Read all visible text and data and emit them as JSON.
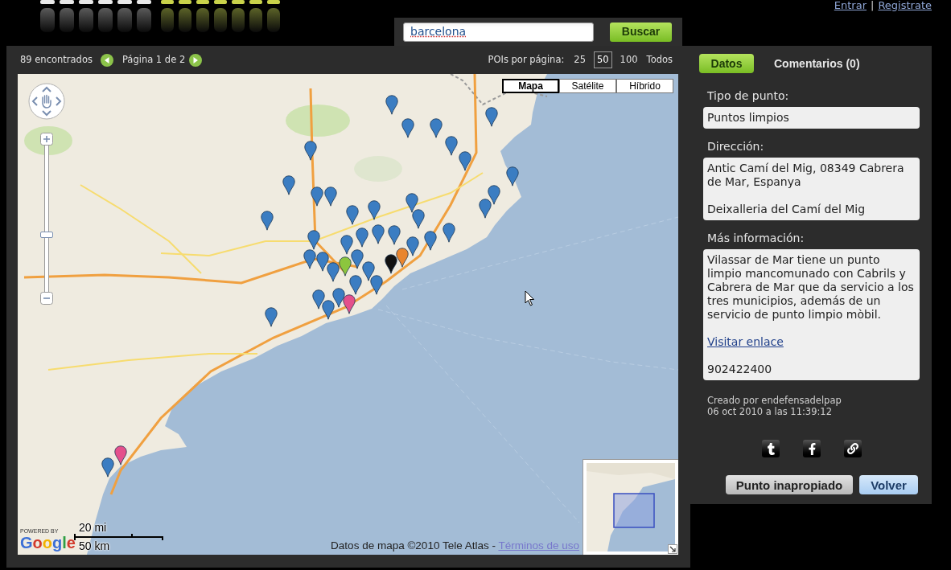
{
  "account": {
    "links": [
      {
        "label": "Entrar"
      },
      {
        "label": "Registrate"
      }
    ],
    "separator": "|"
  },
  "search": {
    "value": "barcelona",
    "button": "Buscar"
  },
  "results_bar": {
    "count": "89 encontrados",
    "page": "Página 1 de 2",
    "per_page_label": "POIs por página:",
    "per_page_options": [
      {
        "label": "25",
        "selected": false
      },
      {
        "label": "50",
        "selected": true
      },
      {
        "label": "100",
        "selected": false
      },
      {
        "label": "Todos",
        "selected": false
      }
    ]
  },
  "map": {
    "map_types": [
      {
        "label": "Mapa",
        "selected": true
      },
      {
        "label": "Satélite",
        "selected": false
      },
      {
        "label": "Híbrido",
        "selected": false
      }
    ],
    "zoom": {
      "level": 0.39
    },
    "scale": {
      "miles": "20 mi",
      "kilometers": "50 km"
    },
    "logo": {
      "caption": "POWERED BY",
      "name": "Google"
    },
    "attribution": "Datos de mapa ©2010 Tele Atlas -",
    "terms_link": "Términos de uso",
    "markers": [
      {
        "color": "#3b7dc2"
      },
      {
        "color": "#3b7dc2"
      },
      {
        "color": "#3b7dc2"
      },
      {
        "color": "#3b7dc2"
      },
      {
        "color": "#3b7dc2"
      },
      {
        "color": "#3b7dc2"
      },
      {
        "color": "#3b7dc2"
      },
      {
        "color": "#3b7dc2"
      },
      {
        "color": "#3b7dc2"
      },
      {
        "color": "#3b7dc2"
      },
      {
        "color": "#3b7dc2"
      },
      {
        "color": "#3b7dc2"
      },
      {
        "color": "#3b7dc2"
      },
      {
        "color": "#3b7dc2"
      },
      {
        "color": "#3b7dc2"
      },
      {
        "color": "#3b7dc2"
      },
      {
        "color": "#3b7dc2"
      },
      {
        "color": "#3b7dc2"
      },
      {
        "color": "#3b7dc2"
      },
      {
        "color": "#3b7dc2"
      },
      {
        "color": "#3b7dc2"
      },
      {
        "color": "#3b7dc2"
      },
      {
        "color": "#3b7dc2"
      },
      {
        "color": "#3b7dc2"
      },
      {
        "color": "#3b7dc2"
      },
      {
        "color": "#3b7dc2"
      },
      {
        "color": "#3b7dc2"
      },
      {
        "color": "#3b7dc2"
      },
      {
        "color": "#3b7dc2"
      },
      {
        "color": "#3b7dc2"
      },
      {
        "color": "#3b7dc2"
      },
      {
        "color": "#3b7dc2"
      },
      {
        "color": "#3b7dc2"
      },
      {
        "color": "#3b7dc2"
      },
      {
        "color": "#3b7dc2"
      },
      {
        "color": "#3b7dc2"
      },
      {
        "color": "#3b7dc2"
      },
      {
        "color": "#3b7dc2"
      },
      {
        "color": "#e9852e"
      },
      {
        "color": "#8cc63e"
      },
      {
        "color": "#111111"
      },
      {
        "color": "#e4508c"
      },
      {
        "color": "#e4508c"
      }
    ]
  },
  "details": {
    "tabs": [
      {
        "label": "Datos",
        "selected": true
      },
      {
        "label": "Comentarios (0)",
        "selected": false
      }
    ],
    "fields": [
      {
        "label": "Tipo de punto:",
        "paragraphs": [
          {
            "kind": "text",
            "text": "Puntos limpios"
          }
        ]
      },
      {
        "label": "Dirección:",
        "paragraphs": [
          {
            "kind": "text",
            "text": "Antic Camí del Mig, 08349 Cabrera de Mar, Espanya"
          },
          {
            "kind": "text",
            "text": "Deixalleria del Camí del Mig"
          }
        ]
      },
      {
        "label": "Más información:",
        "paragraphs": [
          {
            "kind": "text",
            "text": "Vilassar de Mar tiene un punto limpio mancomunado con Cabrils y Cabrera de Mar que da servicio a los tres municipios, además de un servicio de punto limpio mòbil."
          },
          {
            "kind": "link",
            "text": "Visitar enlace"
          },
          {
            "kind": "text",
            "text": "902422400"
          }
        ]
      }
    ],
    "created_by": "Creado por endefensadelpap",
    "created_at": "06 oct 2010 a las 11:39:12",
    "actions": [
      {
        "label": "Punto inapropiado",
        "kind": "secondary"
      },
      {
        "label": "Volver",
        "kind": "primary"
      }
    ]
  }
}
